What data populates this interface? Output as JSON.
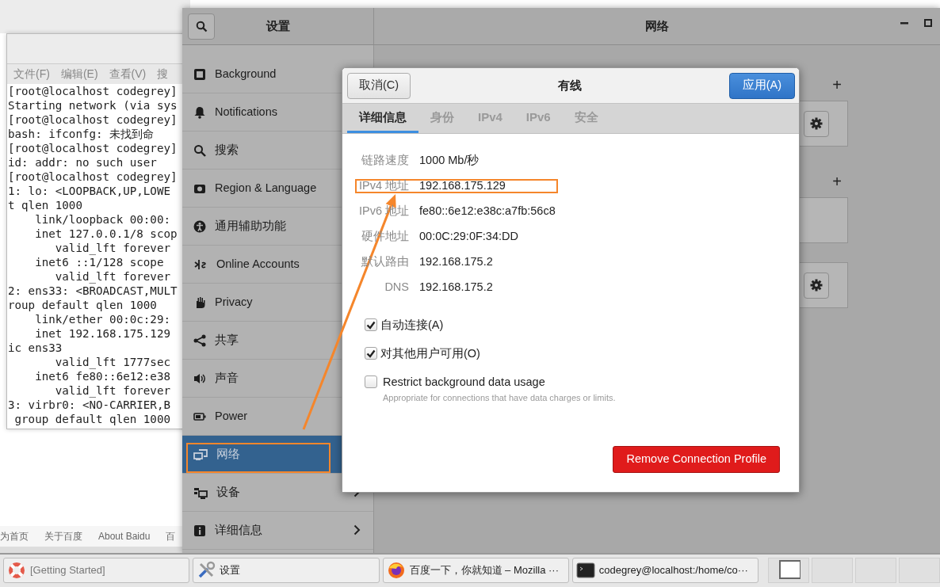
{
  "browser_footer": {
    "links": [
      "为首页",
      "关于百度",
      "About Baidu",
      "百"
    ]
  },
  "terminal": {
    "menu": [
      "文件(F)",
      "编辑(E)",
      "查看(V)",
      "搜"
    ],
    "lines": [
      "[root@localhost codegrey]",
      "Starting network (via sys",
      "[root@localhost codegrey]",
      "bash: ifconfg: 未找到命",
      "[root@localhost codegrey]",
      "id: addr: no such user",
      "[root@localhost codegrey]",
      "1: lo: <LOOPBACK,UP,LOWE",
      "t qlen 1000",
      "    link/loopback 00:00:",
      "    inet 127.0.0.1/8 scop",
      "       valid_lft forever",
      "    inet6 ::1/128 scope",
      "       valid_lft forever",
      "2: ens33: <BROADCAST,MULT",
      "roup default qlen 1000",
      "    link/ether 00:0c:29:",
      "    inet 192.168.175.129",
      "ic ens33",
      "       valid_lft 1777sec",
      "    inet6 fe80::6e12:e38",
      "       valid_lft forever",
      "3: virbr0: <NO-CARRIER,B",
      " group default qlen 1000"
    ]
  },
  "settings": {
    "title": "设置",
    "panel_title": "网络",
    "sidebar": [
      {
        "label": "Background",
        "selected": false
      },
      {
        "label": "Notifications",
        "selected": false
      },
      {
        "label": "搜索",
        "selected": false
      },
      {
        "label": "Region & Language",
        "selected": false
      },
      {
        "label": "通用辅助功能",
        "selected": false
      },
      {
        "label": "Online Accounts",
        "selected": false
      },
      {
        "label": "Privacy",
        "selected": false
      },
      {
        "label": "共享",
        "selected": false
      },
      {
        "label": "声音",
        "selected": false
      },
      {
        "label": "Power",
        "selected": false
      },
      {
        "label": "网络",
        "selected": true,
        "highlighted": true
      },
      {
        "label": "设备",
        "selected": false,
        "chevron": true
      },
      {
        "label": "详细信息",
        "selected": false,
        "chevron": true
      }
    ],
    "sections": [
      {
        "add_label": "+",
        "panels": [
          {
            "gear": true
          }
        ]
      },
      {
        "add_label": "+",
        "panels": [
          {
            "gear": false
          },
          {
            "gear": true
          }
        ]
      }
    ]
  },
  "dialog": {
    "cancel": "取消(C)",
    "title": "有线",
    "apply": "应用(A)",
    "tabs": [
      {
        "label": "详细信息",
        "selected": true
      },
      {
        "label": "身份",
        "selected": false
      },
      {
        "label": "IPv4",
        "selected": false
      },
      {
        "label": "IPv6",
        "selected": false
      },
      {
        "label": "安全",
        "selected": false
      }
    ],
    "details": [
      {
        "label": "链路速度",
        "value": "1000 Mb/秒"
      },
      {
        "label": "IPv4 地址",
        "value": "192.168.175.129",
        "highlighted": true
      },
      {
        "label": "IPv6 地址",
        "value": "fe80::6e12:e38c:a7fb:56c8"
      },
      {
        "label": "硬件地址",
        "value": "00:0C:29:0F:34:DD"
      },
      {
        "label": "默认路由",
        "value": "192.168.175.2"
      },
      {
        "label": "DNS",
        "value": "192.168.175.2"
      }
    ],
    "options": [
      {
        "label": "自动连接(A)",
        "checked": true
      },
      {
        "label": "对其他用户可用(O)",
        "checked": true
      },
      {
        "label": "Restrict background data usage",
        "description": "Appropriate for connections that have data charges or limits.",
        "checked": false
      }
    ],
    "remove_button": "Remove Connection Profile",
    "annotation_arrow": true
  },
  "taskbar": [
    {
      "label": "[Getting Started]"
    },
    {
      "label": "设置"
    },
    {
      "label": "百度一下，你就知道 – Mozilla ···"
    },
    {
      "label": "codegrey@localhost:/home/co···"
    }
  ]
}
